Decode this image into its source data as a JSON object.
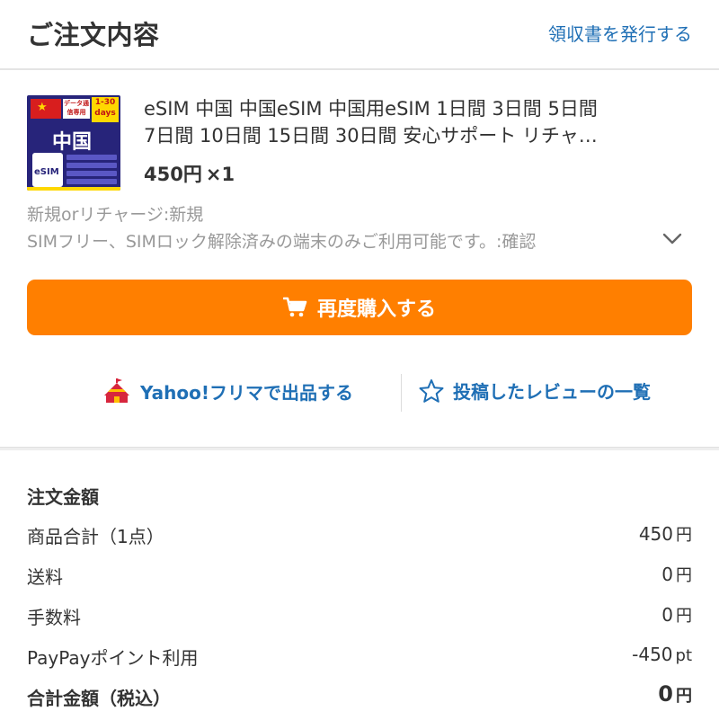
{
  "header": {
    "title": "ご注文内容",
    "receipt_link": "領収書を発行する"
  },
  "product": {
    "thumbnail": {
      "data_tag": "データ通信専用",
      "days_tag": "1-30 days",
      "country": "中国",
      "esim_label": "eSIM"
    },
    "name_line1": "eSIM 中国 中国eSIM 中国用eSIM 1日間 3日間 5日間",
    "name_line2": "7日間 10日間 15日間 30日間 安心サポート リチャ…",
    "price": "450円",
    "quantity": "×1",
    "options": [
      "新規orリチャージ:新規",
      "SIMフリー、SIMロック解除済みの端末のみご利用可能です。:確認"
    ]
  },
  "rebuy_button": {
    "label": "再度購入する",
    "icon": "cart-icon"
  },
  "actions": {
    "flea_market": {
      "label": "Yahoo!フリマで出品する",
      "icon": "tent-icon"
    },
    "reviews": {
      "label": "投稿したレビューの一覧",
      "icon": "star-outline-icon"
    }
  },
  "summary": {
    "title": "注文金額",
    "rows": [
      {
        "label": "商品合計（1点）",
        "value": "450",
        "unit": "円"
      },
      {
        "label": "送料",
        "value": "0",
        "unit": "円"
      },
      {
        "label": "手数料",
        "value": "0",
        "unit": "円"
      },
      {
        "label": "PayPayポイント利用",
        "value": "-450",
        "unit": "pt"
      },
      {
        "label": "合計金額（税込）",
        "value": "0",
        "unit": "円"
      }
    ]
  },
  "colors": {
    "accent_orange": "#ff7f00",
    "link_blue": "#1f6fb5",
    "text": "#333333",
    "muted": "#999999",
    "tent_red": "#d7263d"
  }
}
